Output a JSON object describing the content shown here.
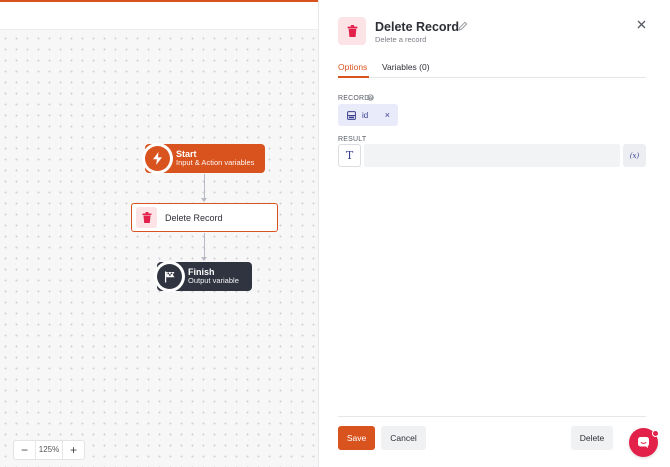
{
  "flow": {
    "start": {
      "title": "Start",
      "subtitle": "Input & Action variables"
    },
    "delete": {
      "title": "Delete Record"
    },
    "finish": {
      "title": "Finish",
      "subtitle": "Output variable"
    }
  },
  "zoom": {
    "minus": "−",
    "value": "125%",
    "plus": "+"
  },
  "panel": {
    "title": "Delete Record",
    "subtitle": "Delete a record",
    "tabs": [
      {
        "label": "Options",
        "active": true
      },
      {
        "label": "Variables (0)",
        "active": false
      }
    ],
    "record": {
      "label": "RECORD",
      "chip": "id",
      "remove": "×"
    },
    "result": {
      "label": "RESULT",
      "type_glyph": "T",
      "value": "",
      "var_label": "(x)"
    },
    "buttons": {
      "save": "Save",
      "cancel": "Cancel",
      "delete": "Delete"
    }
  },
  "colors": {
    "accent": "#d9531e",
    "finish": "#2f3440",
    "chip_bg": "#e9ebfa",
    "chat": "#e2204a"
  }
}
